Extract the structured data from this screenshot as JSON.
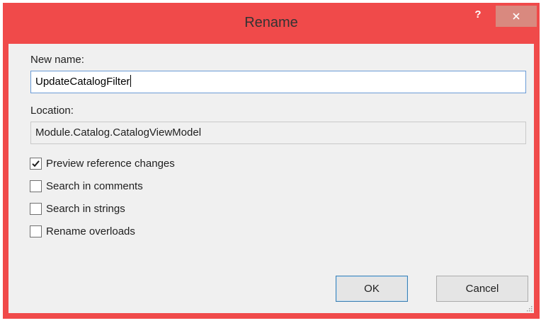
{
  "window": {
    "title": "Rename",
    "help_glyph": "?",
    "accent_color": "#f04a4a"
  },
  "form": {
    "new_name_label": "New name:",
    "new_name_value": "UpdateCatalogFilter",
    "location_label": "Location:",
    "location_value": "Module.Catalog.CatalogViewModel"
  },
  "options": [
    {
      "label": "Preview reference changes",
      "checked": true
    },
    {
      "label": "Search in comments",
      "checked": false
    },
    {
      "label": "Search in strings",
      "checked": false
    },
    {
      "label": "Rename overloads",
      "checked": false
    }
  ],
  "buttons": {
    "ok_label": "OK",
    "cancel_label": "Cancel"
  },
  "icons": {
    "close": "close-icon",
    "check": "checkmark-icon",
    "resize": "resize-grip-icon"
  }
}
